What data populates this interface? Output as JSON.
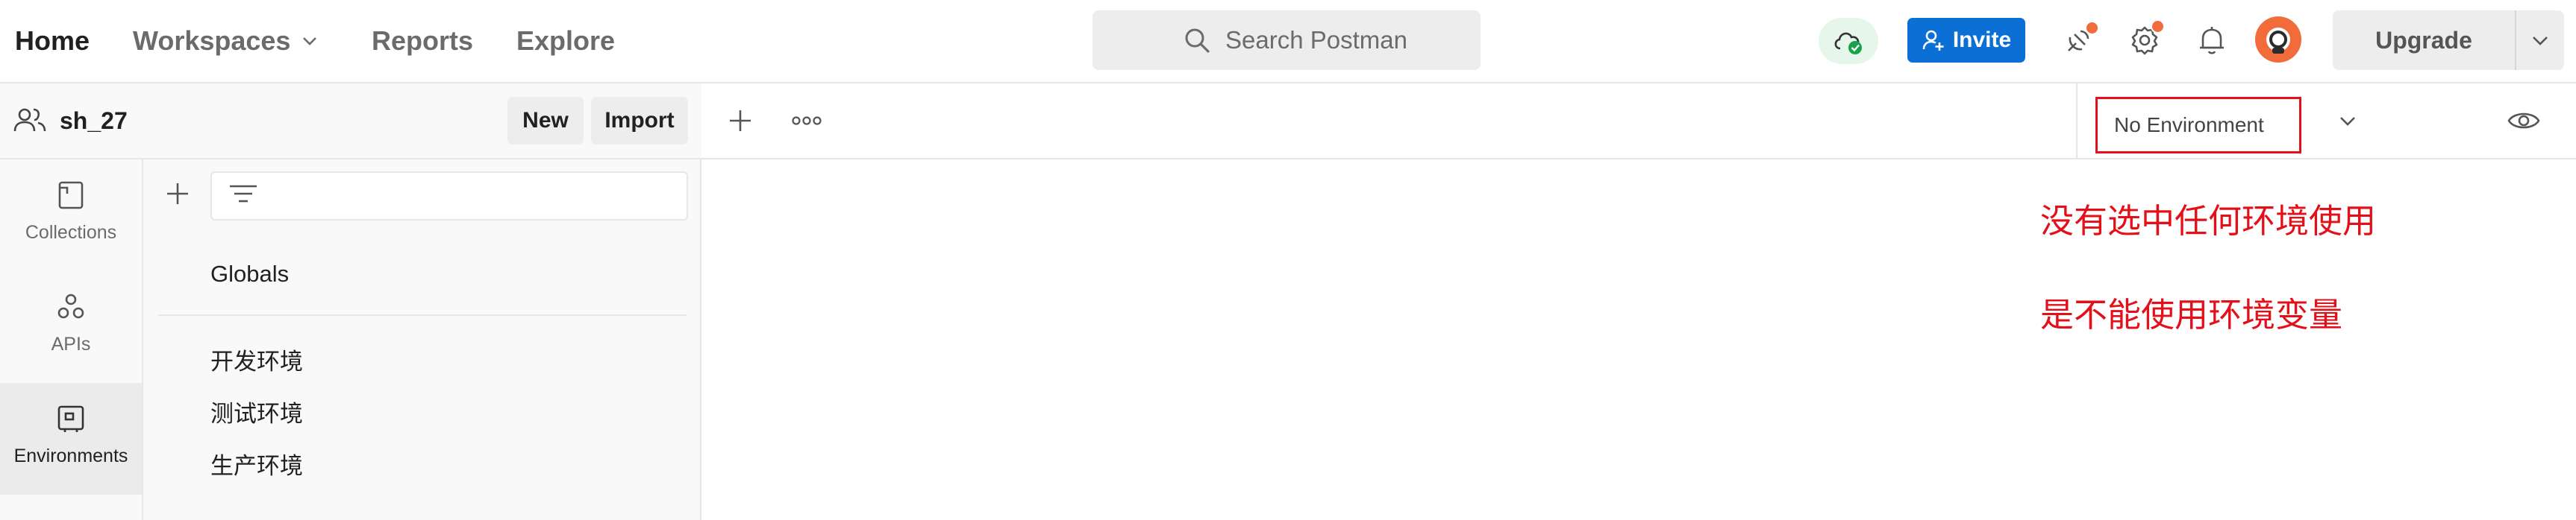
{
  "nav": {
    "home": "Home",
    "workspaces": "Workspaces",
    "reports": "Reports",
    "explore": "Explore"
  },
  "search": {
    "placeholder": "Search Postman"
  },
  "header_actions": {
    "invite": "Invite",
    "upgrade": "Upgrade"
  },
  "workspace": {
    "name": "sh_27",
    "new_label": "New",
    "import_label": "Import"
  },
  "rail": {
    "items": [
      {
        "label": "Collections",
        "icon": "collections-icon"
      },
      {
        "label": "APIs",
        "icon": "apis-icon"
      },
      {
        "label": "Environments",
        "icon": "environments-icon",
        "active": true
      }
    ]
  },
  "environments": {
    "globals": "Globals",
    "items": [
      "开发环境",
      "测试环境",
      "生产环境"
    ]
  },
  "env_selector": {
    "value": "No Environment"
  },
  "annotations": {
    "line1": "没有选中任何环境使用",
    "line2": "是不能使用环境变量"
  },
  "colors": {
    "accent_blue": "#0c6fd6",
    "notification_orange": "#f26b3a",
    "annotation_red": "#e3101a",
    "sync_green": "#16a34a"
  }
}
